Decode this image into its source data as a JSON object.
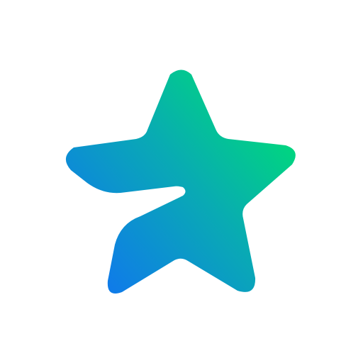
{
  "logo": {
    "icon": "star-logo-icon",
    "gradient": {
      "start": "#0f7ce8",
      "mid": "#09aab4",
      "end": "#00d67f"
    }
  },
  "background": "#ffffff"
}
